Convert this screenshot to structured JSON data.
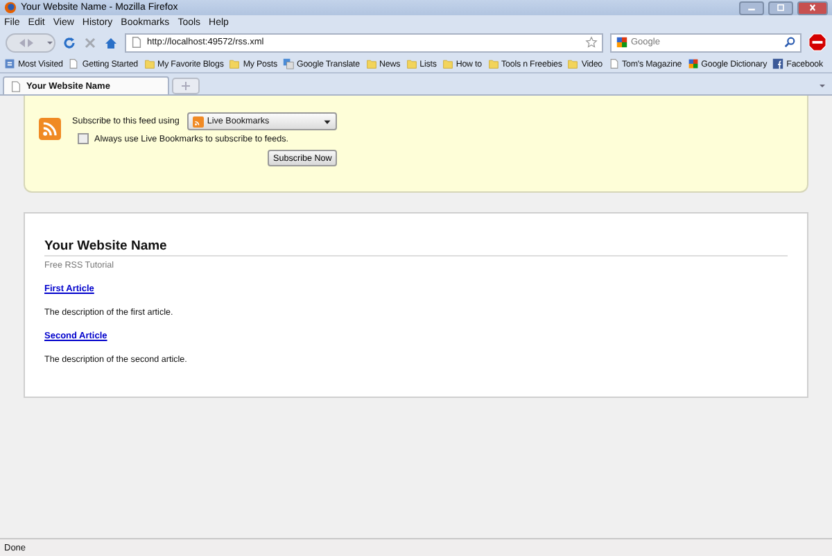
{
  "window": {
    "title": "Your Website Name - Mozilla Firefox"
  },
  "menu": [
    "File",
    "Edit",
    "View",
    "History",
    "Bookmarks",
    "Tools",
    "Help"
  ],
  "address": {
    "value": "http://localhost:49572/rss.xml"
  },
  "search": {
    "placeholder": "Google"
  },
  "bookmarks": [
    {
      "label": "Most Visited",
      "kind": "star"
    },
    {
      "label": "Getting Started",
      "kind": "page"
    },
    {
      "label": "My Favorite Blogs",
      "kind": "folder"
    },
    {
      "label": "My Posts",
      "kind": "folder"
    },
    {
      "label": "Google Translate",
      "kind": "translate"
    },
    {
      "label": "News",
      "kind": "folder"
    },
    {
      "label": "Lists",
      "kind": "folder"
    },
    {
      "label": "How to",
      "kind": "folder"
    },
    {
      "label": "Tools n Freebies",
      "kind": "folder"
    },
    {
      "label": "Video",
      "kind": "folder"
    },
    {
      "label": "Tom's Magazine",
      "kind": "page"
    },
    {
      "label": "Google Dictionary",
      "kind": "google"
    },
    {
      "label": "Facebook",
      "kind": "facebook"
    }
  ],
  "tabs": [
    {
      "label": "Your Website Name",
      "selected": true
    }
  ],
  "subscribe": {
    "prompt": "Subscribe to this feed using",
    "reader": "Live Bookmarks",
    "always_label": "Always use Live Bookmarks to subscribe to feeds.",
    "always_checked": false,
    "button": "Subscribe Now"
  },
  "feed": {
    "title": "Your Website Name",
    "subtitle": "Free RSS Tutorial",
    "articles": [
      {
        "title": "First Article",
        "description": "The description of the first article."
      },
      {
        "title": "Second Article",
        "description": "The description of the second article."
      }
    ]
  },
  "status_bar": "Done"
}
